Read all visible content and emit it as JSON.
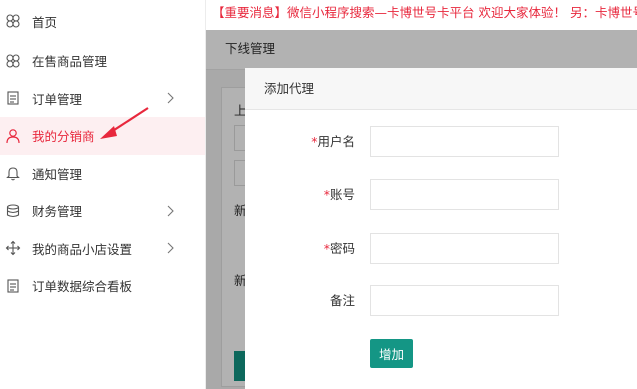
{
  "sidebar": {
    "items": [
      {
        "label": "首页",
        "icon": "flower-icon"
      },
      {
        "label": "在售商品管理",
        "icon": "flower-icon"
      },
      {
        "label": "订单管理",
        "icon": "document-icon",
        "has_submenu": true
      },
      {
        "label": "我的分销商",
        "icon": "user-icon",
        "active": true
      },
      {
        "label": "通知管理",
        "icon": "bell-icon"
      },
      {
        "label": "财务管理",
        "icon": "database-icon",
        "has_submenu": true
      },
      {
        "label": "我的商品小店设置",
        "icon": "move-icon",
        "has_submenu": true
      },
      {
        "label": "订单数据综合看板",
        "icon": "document-icon"
      }
    ]
  },
  "notice": {
    "text": "【重要消息】微信小程序搜索—卡博世号卡平台 欢迎大家体验！ 另：卡博世号"
  },
  "main": {
    "page_title": "下线管理",
    "background_fragments": [
      "上",
      "新",
      "新"
    ]
  },
  "modal": {
    "title": "添加代理",
    "fields": [
      {
        "label": "用户名",
        "required": true,
        "value": "",
        "placeholder": ""
      },
      {
        "label": "账号",
        "required": true,
        "value": "",
        "placeholder": ""
      },
      {
        "label": "密码",
        "required": true,
        "value": "",
        "placeholder": ""
      },
      {
        "label": "备注",
        "required": false,
        "value": "",
        "placeholder": ""
      }
    ],
    "required_mark": "*",
    "submit_label": "增加"
  },
  "colors": {
    "accent_red": "#e8283d",
    "button_green": "#149685",
    "active_bg": "#fdeff1"
  }
}
